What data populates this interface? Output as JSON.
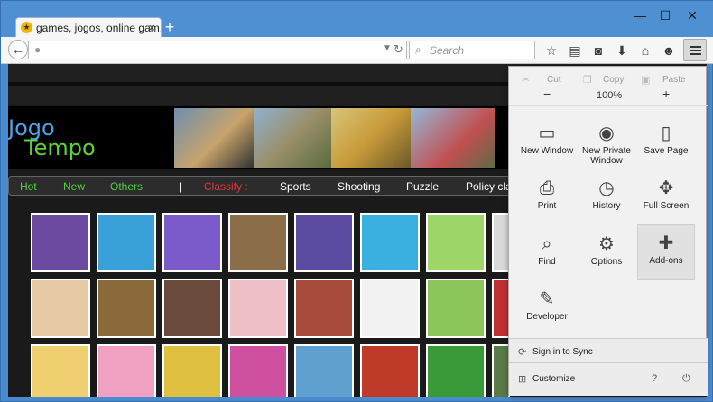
{
  "browser": {
    "tab_title": "games, jogos, online gam...",
    "tab_close": "×",
    "new_tab": "+",
    "window_controls": [
      "—",
      "☐",
      "✕"
    ],
    "url_text": "",
    "search_placeholder": "Search",
    "toolbar_icons": [
      "bookmark-star-icon",
      "reading-list-icon",
      "pocket-icon",
      "download-icon",
      "home-icon",
      "chat-icon"
    ]
  },
  "site": {
    "logo_line1": "Jogo",
    "logo_line2": "Tempo",
    "nav": {
      "hot": "Hot",
      "new": "New",
      "others": "Others",
      "classify": "Classify :",
      "sports": "Sports",
      "shooting": "Shooting",
      "puzzle": "Puzzle",
      "policy": "Policy cla"
    },
    "nav_colors": {
      "hot": "#4fd13a",
      "classify": "#e8323d",
      "white": "#ffffff"
    }
  },
  "menu": {
    "cut": "Cut",
    "copy": "Copy",
    "paste": "Paste",
    "zoom_minus": "−",
    "zoom_value": "100%",
    "zoom_plus": "+",
    "items": [
      {
        "label": "New Window"
      },
      {
        "label": "New Private Window"
      },
      {
        "label": "Save Page"
      },
      {
        "label": "Print"
      },
      {
        "label": "History"
      },
      {
        "label": "Full Screen"
      },
      {
        "label": "Find"
      },
      {
        "label": "Options"
      },
      {
        "label": "Add-ons"
      },
      {
        "label": "Developer"
      }
    ],
    "sign_in": "Sign in to Sync",
    "customize": "Customize"
  }
}
